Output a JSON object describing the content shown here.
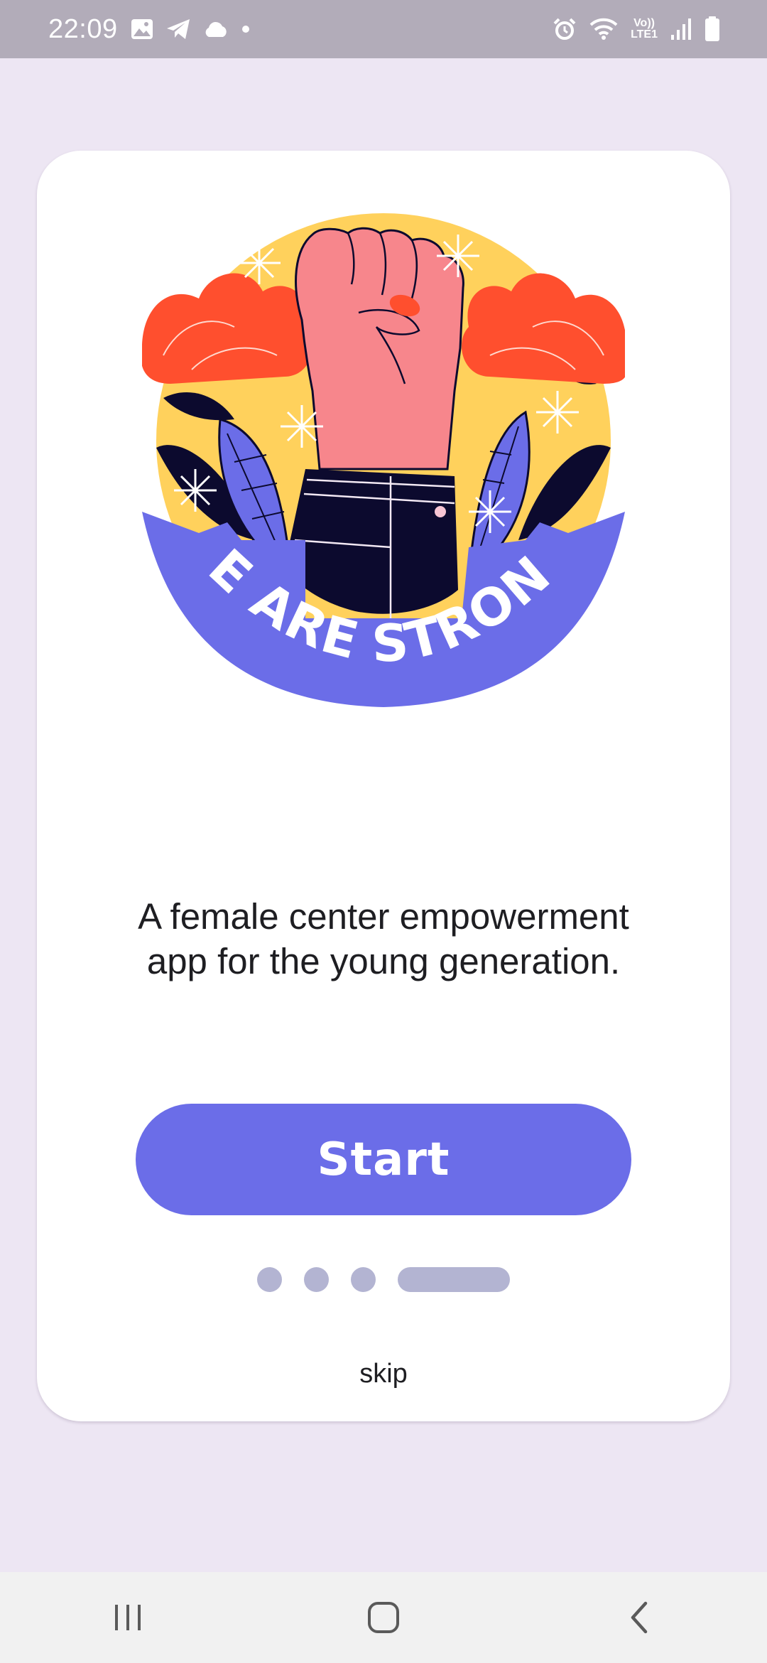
{
  "status_bar": {
    "time": "22:09",
    "left_icons": [
      "gallery-icon",
      "telegram-icon",
      "cloud-icon",
      "dot-icon"
    ],
    "right_icons": [
      "alarm-icon",
      "wifi-icon",
      "volte-icon",
      "signal-icon",
      "battery-icon"
    ],
    "network_label_top": "Vo))",
    "network_label_bottom": "LTE1"
  },
  "onboarding": {
    "illustration": {
      "banner_text": "WE ARE STRONG!",
      "icon": "raised-fist-illustration"
    },
    "tagline": "A female center empowerment app for the young generation.",
    "start_label": "Start",
    "pager": {
      "total": 4,
      "active_index": 3
    },
    "skip_label": "skip"
  },
  "nav_bar": {
    "buttons": [
      "recent-apps-icon",
      "home-icon",
      "back-icon"
    ]
  },
  "colors": {
    "background": "#ede6f3",
    "card": "#ffffff",
    "accent": "#6b6de8",
    "pager": "#b3b4d2",
    "status_bar": "#b2acb9",
    "sticker_yellow": "#ffd15c",
    "sticker_red": "#ff4f2e",
    "fist_pink": "#f7868c",
    "navy": "#0c0a2e"
  }
}
